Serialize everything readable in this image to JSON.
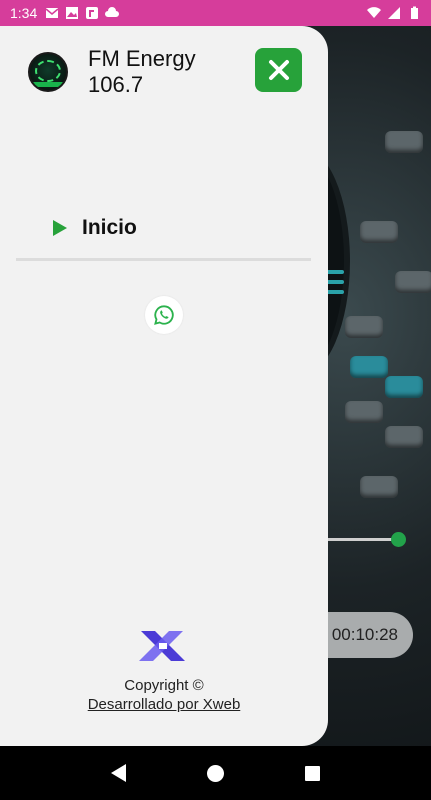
{
  "status_bar": {
    "time": "1:34",
    "left_icons": [
      "mail-icon",
      "gallery-icon",
      "app-icon",
      "cloud-icon"
    ],
    "right_icons": [
      "wifi-icon",
      "signal-icon",
      "battery-icon"
    ],
    "color": "#d63d9b"
  },
  "drawer": {
    "station_name": "FM Energy\n106.7",
    "station_name_line1": "FM Energy",
    "station_name_line2": "106.7",
    "close_icon": "close-icon",
    "accent": "#27a23a",
    "menu": [
      {
        "label": "Inicio",
        "icon": "play-icon"
      }
    ],
    "social": [
      {
        "icon": "whatsapp-icon"
      }
    ],
    "footer": {
      "copyright": "Copyright ©",
      "developer_link": "Desarrollado por Xweb"
    }
  },
  "background": {
    "timer": "00:10:28",
    "slider_level": 0.95
  },
  "nav_bar": {
    "icons": [
      "back-icon",
      "home-icon",
      "recents-icon"
    ]
  }
}
